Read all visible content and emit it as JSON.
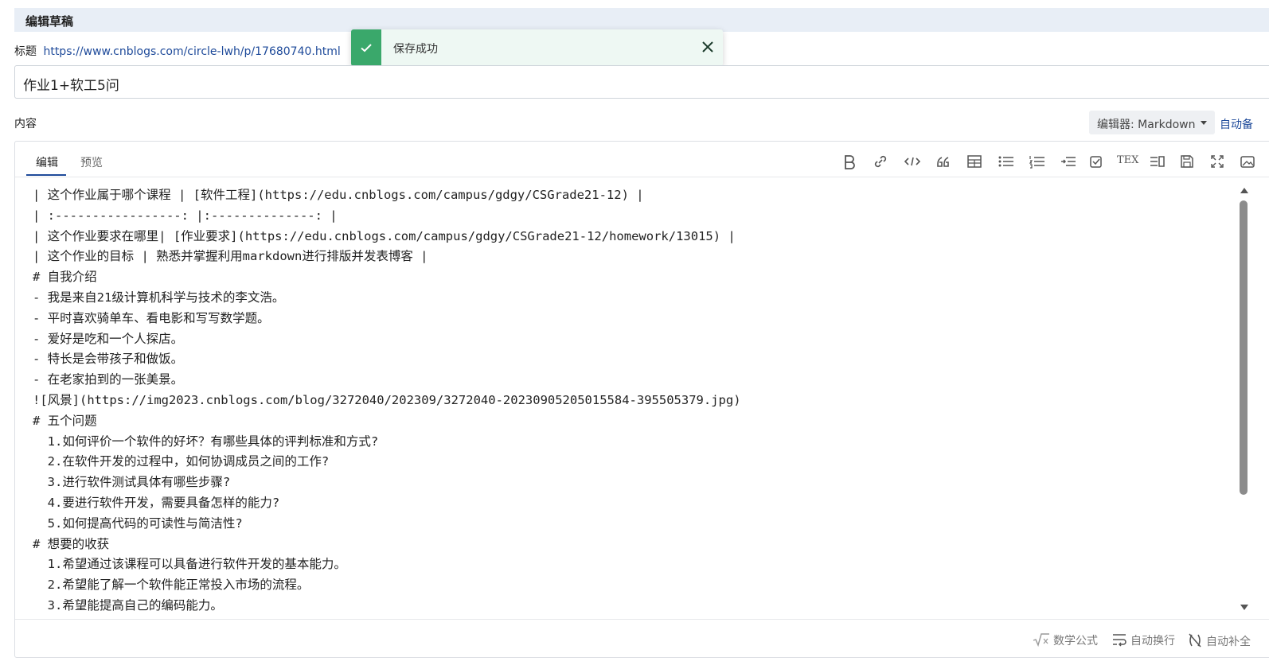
{
  "section": {
    "title": "编辑草稿"
  },
  "title_row": {
    "label": "标题",
    "url": "https://www.cnblogs.com/circle-lwh/p/17680740.html"
  },
  "toast": {
    "message": "保存成功"
  },
  "title_input": {
    "value": "作业1+软工5问"
  },
  "content": {
    "label": "内容"
  },
  "editor_select": {
    "value": "编辑器: Markdown"
  },
  "autosave": {
    "label": "自动备"
  },
  "tabs": [
    {
      "label": "编辑",
      "active": true
    },
    {
      "label": "预览",
      "active": false
    }
  ],
  "toolbar_icons": [
    "bold-icon",
    "link-icon",
    "code-icon",
    "quote-icon",
    "table-icon",
    "unordered-list-icon",
    "ordered-list-icon",
    "indent-icon",
    "checkbox-icon",
    "tex-icon",
    "toc-icon",
    "save-icon",
    "fullscreen-icon",
    "image-icon"
  ],
  "toolbar_tex_label": "TEX",
  "editor_lines": [
    "| 这个作业属于哪个课程 | [软件工程](https://edu.cnblogs.com/campus/gdgy/CSGrade21-12) |",
    "| :-----------------: |:--------------: |",
    "| 这个作业要求在哪里| [作业要求](https://edu.cnblogs.com/campus/gdgy/CSGrade21-12/homework/13015) |",
    "| 这个作业的目标 | 熟悉并掌握利用markdown进行排版并发表博客 |",
    "# 自我介绍",
    "- 我是来自21级计算机科学与技术的李文浩。",
    "- 平时喜欢骑单车、看电影和写写数学题。",
    "- 爱好是吃和一个人探店。",
    "- 特长是会带孩子和做饭。",
    "- 在老家拍到的一张美景。",
    "![风景](https://img2023.cnblogs.com/blog/3272040/202309/3272040-20230905205015584-395505379.jpg)",
    "# 五个问题",
    "  1.如何评价一个软件的好坏？有哪些具体的评判标准和方式?",
    "  2.在软件开发的过程中，如何协调成员之间的工作?",
    "  3.进行软件测试具体有哪些步骤?",
    "  4.要进行软件开发，需要具备怎样的能力?",
    "  5.如何提高代码的可读性与简洁性?",
    "# 想要的收获",
    "  1.希望通过该课程可以具备进行软件开发的基本能力。",
    "  2.希望能了解一个软件能正常投入市场的流程。",
    "  3.希望能提高自己的编码能力。"
  ],
  "footer": {
    "math": "数学公式",
    "wrap": "自动换行",
    "autocomplete": "自动补全"
  },
  "colors": {
    "accent": "#1e4a9a",
    "success": "#3aa86b",
    "toast_bg": "#eef8f3",
    "header_bg": "#e8eef6"
  }
}
